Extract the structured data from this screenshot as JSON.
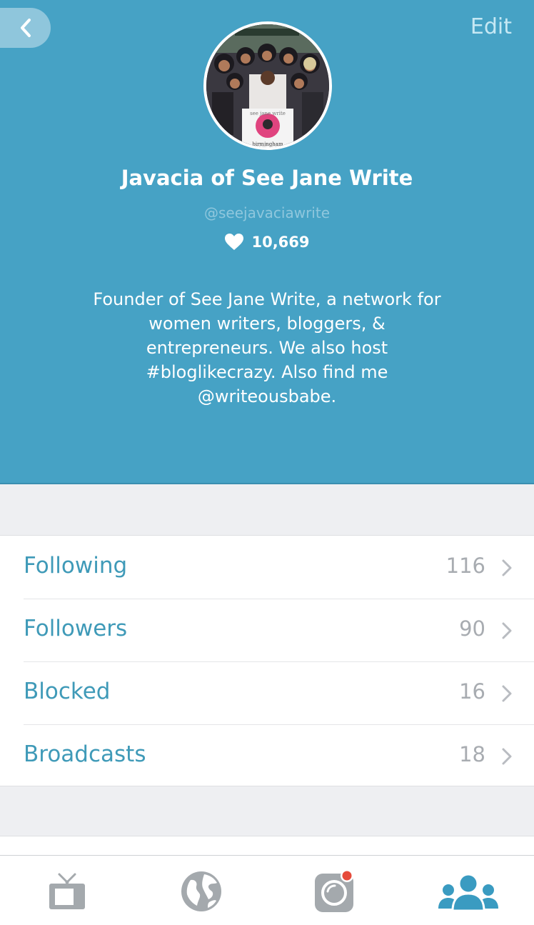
{
  "header": {
    "edit_label": "Edit",
    "display_name": "Javacia of See Jane Write",
    "username": "@seejavaciawrite",
    "hearts_count": "10,669",
    "bio": "Founder of See Jane Write, a network for women writers, bloggers, & entrepreneurs. We also host #bloglikecrazy. Also find me @writeousbabe.",
    "avatar_sign_top": "see jane write",
    "avatar_sign_bottom": "birmingham"
  },
  "profile_links": [
    {
      "label": "Following",
      "count": "116"
    },
    {
      "label": "Followers",
      "count": "90"
    },
    {
      "label": "Blocked",
      "count": "16"
    },
    {
      "label": "Broadcasts",
      "count": "18"
    }
  ],
  "tabbar": {
    "tabs": [
      {
        "icon": "tv-icon",
        "active": false
      },
      {
        "icon": "globe-icon",
        "active": false
      },
      {
        "icon": "camera-broadcast-icon",
        "active": false,
        "badge": true
      },
      {
        "icon": "people-icon",
        "active": true
      }
    ]
  },
  "colors": {
    "header_bg": "#46a2c5",
    "accent": "#3f9ab8",
    "tab_inactive": "#a4a9ad",
    "tab_active": "#3a9bc1",
    "badge": "#e64b3b"
  }
}
